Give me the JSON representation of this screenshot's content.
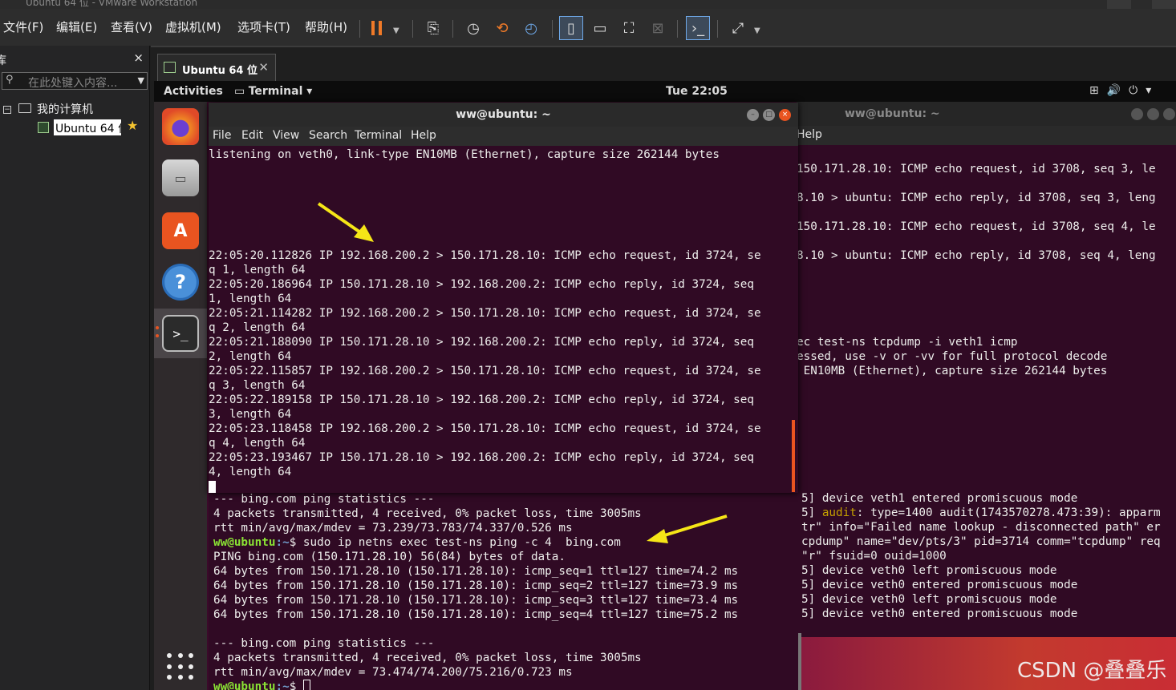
{
  "vmware": {
    "title": "Ubuntu 64 位 - VMware Workstation",
    "menus": [
      "文件(F)",
      "编辑(E)",
      "查看(V)",
      "虚拟机(M)",
      "选项卡(T)",
      "帮助(H)"
    ]
  },
  "library": {
    "title": "库",
    "close": "×",
    "search_placeholder": "在此处键入内容...",
    "tree": {
      "my_computer": "我的计算机",
      "vm_name": "Ubuntu 64 位"
    }
  },
  "vm_tab": {
    "label": "Ubuntu 64 位",
    "close": "✕"
  },
  "ubuntu_topbar": {
    "activities": "Activities",
    "app": "Terminal ▾",
    "clock": "Tue 22:05"
  },
  "dock_items": [
    "firefox-icon",
    "files-icon",
    "software-icon",
    "help-icon",
    "terminal-icon"
  ],
  "terminal_front": {
    "title": "ww@ubuntu: ~",
    "menu": [
      "File",
      "Edit",
      "View",
      "Search",
      "Terminal",
      "Help"
    ],
    "upper_lines": [
      "listening on veth0, link-type EN10MB (Ethernet), capture size 262144 bytes",
      "",
      "",
      "",
      "",
      "",
      "",
      "22:05:20.112826 IP 192.168.200.2 > 150.171.28.10: ICMP echo request, id 3724, se",
      "q 1, length 64",
      "22:05:20.186964 IP 150.171.28.10 > 192.168.200.2: ICMP echo reply, id 3724, seq",
      "1, length 64",
      "22:05:21.114282 IP 192.168.200.2 > 150.171.28.10: ICMP echo request, id 3724, se",
      "q 2, length 64",
      "22:05:21.188090 IP 150.171.28.10 > 192.168.200.2: ICMP echo reply, id 3724, seq",
      "2, length 64",
      "22:05:22.115857 IP 192.168.200.2 > 150.171.28.10: ICMP echo request, id 3724, se",
      "q 3, length 64",
      "22:05:22.189158 IP 150.171.28.10 > 192.168.200.2: ICMP echo reply, id 3724, seq",
      "3, length 64",
      "22:05:23.118458 IP 192.168.200.2 > 150.171.28.10: ICMP echo request, id 3724, se",
      "q 4, length 64",
      "22:05:23.193467 IP 150.171.28.10 > 192.168.200.2: ICMP echo reply, id 3724, seq",
      "4, length 64"
    ]
  },
  "terminal_bottom": {
    "stats1": [
      "--- bing.com ping statistics ---",
      "4 packets transmitted, 4 received, 0% packet loss, time 3005ms",
      "rtt min/avg/max/mdev = 73.239/73.783/74.337/0.526 ms"
    ],
    "prompt_user": "ww@ubuntu",
    "prompt_path": ":~",
    "command": "$ sudo ip netns exec test-ns ping -c 4  bing.com",
    "ping_lines": [
      "PING bing.com (150.171.28.10) 56(84) bytes of data.",
      "64 bytes from 150.171.28.10 (150.171.28.10): icmp_seq=1 ttl=127 time=74.2 ms",
      "64 bytes from 150.171.28.10 (150.171.28.10): icmp_seq=2 ttl=127 time=73.9 ms",
      "64 bytes from 150.171.28.10 (150.171.28.10): icmp_seq=3 ttl=127 time=73.4 ms",
      "64 bytes from 150.171.28.10 (150.171.28.10): icmp_seq=4 ttl=127 time=75.2 ms",
      "",
      "--- bing.com ping statistics ---",
      "4 packets transmitted, 4 received, 0% packet loss, time 3005ms",
      "rtt min/avg/max/mdev = 73.474/74.200/75.216/0.723 ms"
    ],
    "final_prompt_end": "$ "
  },
  "terminal_back": {
    "title": "ww@ubuntu: ~",
    "menu_help": "Help",
    "upper_lines": [
      "150.171.28.10: ICMP echo request, id 3708, seq 3, le",
      "",
      "8.10 > ubuntu: ICMP echo reply, id 3708, seq 3, leng",
      "",
      "150.171.28.10: ICMP echo request, id 3708, seq 4, le",
      "",
      "8.10 > ubuntu: ICMP echo reply, id 3708, seq 4, leng"
    ],
    "mid_lines": [
      "ec test-ns tcpdump -i veth1 icmp",
      "essed, use -v or -vv for full protocol decode",
      " EN10MB (Ethernet), capture size 262144 bytes"
    ],
    "lower_lines": [
      "5] device veth1 entered promiscuous mode",
      "5] audit: type=1400 audit(1743570278.473:39): apparm",
      "tr\" info=\"Failed name lookup - disconnected path\" er",
      "cpdump\" name=\"dev/pts/3\" pid=3714 comm=\"tcpdump\" req",
      "\"r\" fsuid=0 ouid=1000",
      "5] device veth0 left promiscuous mode",
      "5] device veth0 entered promiscuous mode",
      "5] device veth0 left promiscuous mode",
      "5] device veth0 entered promiscuous mode"
    ]
  },
  "annotation_color": "#f5e617",
  "watermark": "CSDN @叠叠乐"
}
